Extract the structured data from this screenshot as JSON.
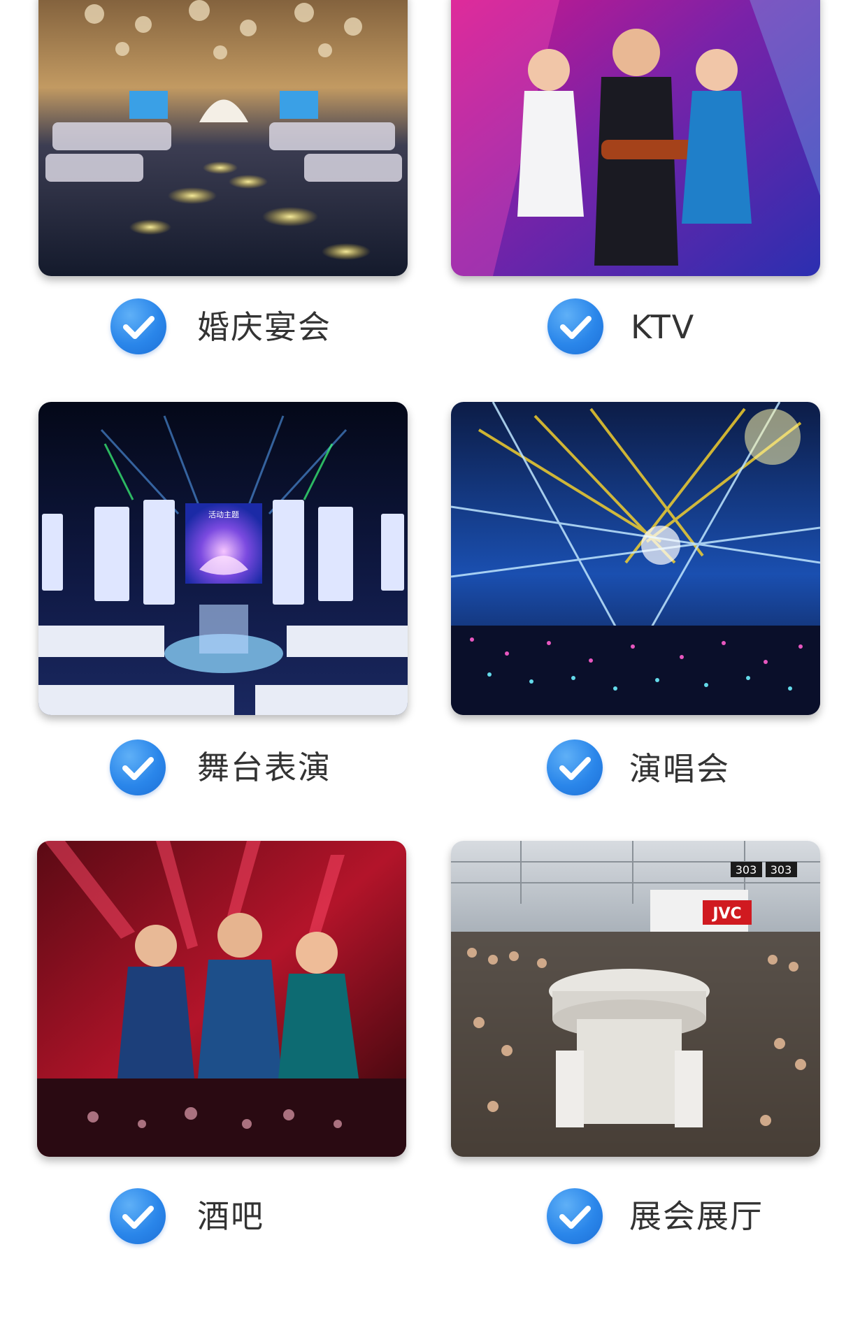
{
  "items": [
    {
      "label": "婚庆宴会",
      "image": "wedding-banquet-photo"
    },
    {
      "label": "KTV",
      "image": "ktv-singers-photo"
    },
    {
      "label": "舞台表演",
      "image": "stage-performance-photo",
      "screen_text": "活动主题"
    },
    {
      "label": "演唱会",
      "image": "concert-lights-photo"
    },
    {
      "label": "酒吧",
      "image": "bar-party-photo"
    },
    {
      "label": "展会展厅",
      "image": "exhibition-hall-photo",
      "signs": [
        "JVC",
        "303",
        "303"
      ]
    }
  ],
  "icons": {
    "check": "check-circle-icon"
  },
  "colors": {
    "accent": "#2a86ea",
    "text": "#333333",
    "background": "#ffffff"
  }
}
